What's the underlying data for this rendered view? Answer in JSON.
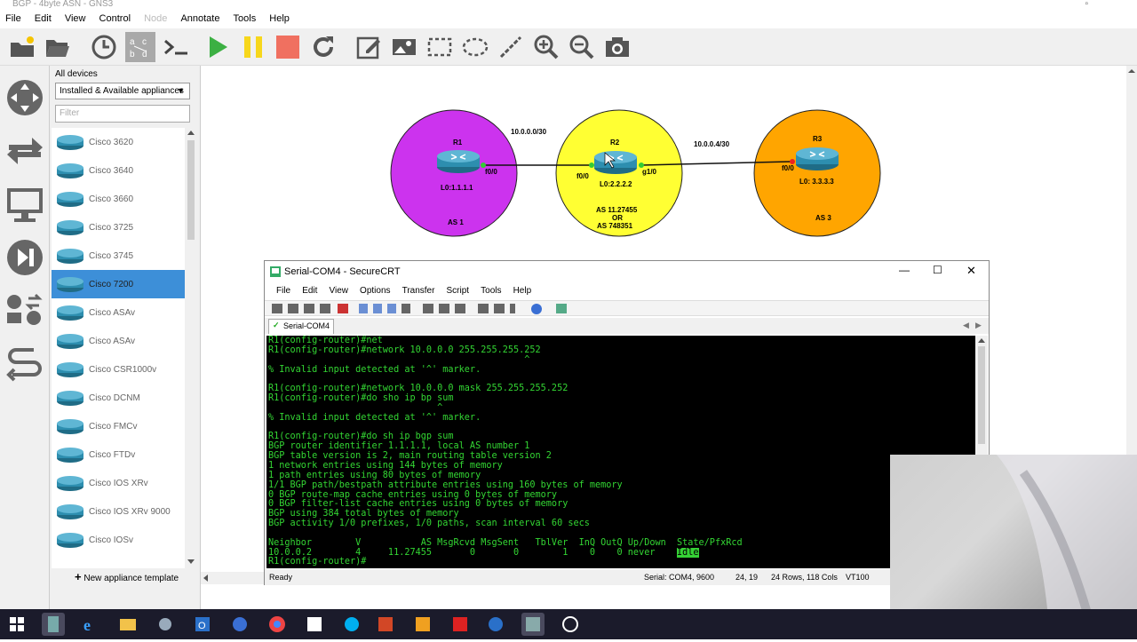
{
  "window": {
    "title": "BGP - 4byte ASN - GNS3"
  },
  "menubar": [
    "File",
    "Edit",
    "View",
    "Control",
    "Node",
    "Annotate",
    "Tools",
    "Help"
  ],
  "device_panel": {
    "header": "All devices",
    "selector": "Installed & Available appliances",
    "filter_placeholder": "Filter",
    "items": [
      "Cisco 3620",
      "Cisco 3640",
      "Cisco 3660",
      "Cisco 3725",
      "Cisco 3745",
      "Cisco 7200",
      "Cisco ASAv",
      "Cisco ASAv",
      "Cisco CSR1000v",
      "Cisco DCNM",
      "Cisco FMCv",
      "Cisco FTDv",
      "Cisco IOS XRv",
      "Cisco IOS XRv 9000",
      "Cisco IOSv"
    ],
    "selected": "Cisco 7200",
    "new_template": "New appliance template"
  },
  "topology": {
    "r1": {
      "name": "R1",
      "loopback": "L0:1.1.1.1",
      "as": "AS 1",
      "iface": "f0/0",
      "color": "#cc33ee"
    },
    "r2": {
      "name": "R2",
      "loopback": "L0:2.2.2.2",
      "as_line1": "AS 11.27455",
      "as_line2": "OR",
      "as_line3": "AS 748351",
      "iface_left": "f0/0",
      "iface_right": "g1/0",
      "color": "#ffff33"
    },
    "r3": {
      "name": "R3",
      "loopback": "L0: 3.3.3.3",
      "as": "AS 3",
      "iface": "f0/0",
      "color": "#ffa500"
    },
    "link1": "10.0.0.0/30",
    "link2": "10.0.0.4/30"
  },
  "securecrt": {
    "title": "Serial-COM4 - SecureCRT",
    "menu": [
      "File",
      "Edit",
      "View",
      "Options",
      "Transfer",
      "Script",
      "Tools",
      "Help"
    ],
    "tab": "Serial-COM4",
    "terminal_lines": [
      "R1(config-router)#net",
      "R1(config-router)#network 10.0.0.0 255.255.255.252",
      "                                               ^",
      "% Invalid input detected at '^' marker.",
      "",
      "R1(config-router)#network 10.0.0.0 mask 255.255.255.252",
      "R1(config-router)#do sho ip bp sum",
      "                               ^",
      "% Invalid input detected at '^' marker.",
      "",
      "R1(config-router)#do sh ip bgp sum",
      "BGP router identifier 1.1.1.1, local AS number 1",
      "BGP table version is 2, main routing table version 2",
      "1 network entries using 144 bytes of memory",
      "1 path entries using 80 bytes of memory",
      "1/1 BGP path/bestpath attribute entries using 160 bytes of memory",
      "0 BGP route-map cache entries using 0 bytes of memory",
      "0 BGP filter-list cache entries using 0 bytes of memory",
      "BGP using 384 total bytes of memory",
      "BGP activity 1/0 prefixes, 1/0 paths, scan interval 60 secs",
      "",
      "Neighbor        V           AS MsgRcvd MsgSent   TblVer  InQ OutQ Up/Down  State/PfxRcd"
    ],
    "neighbor_row": "10.0.0.2        4     11.27455       0       0        1    0    0 never    ",
    "neighbor_state": "Idle",
    "prompt_line": "R1(config-router)#",
    "status": {
      "ready": "Ready",
      "port": "Serial: COM4, 9600",
      "cursor": "24, 19",
      "size": "24 Rows, 118 Cols",
      "emulation": "VT100"
    }
  }
}
